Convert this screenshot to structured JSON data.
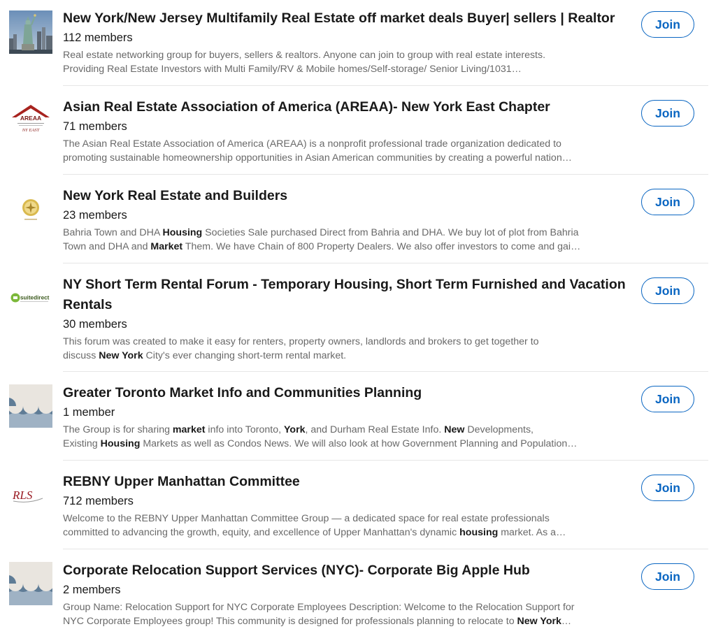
{
  "colors": {
    "accent": "#0a66c2",
    "title": "#000000e6",
    "secondary": "#00000099"
  },
  "groups": [
    {
      "title": "New York/New Jersey Multifamily Real Estate off market deals Buyer| sellers | Realtor",
      "members": "112 members",
      "logo_icon": "statue-of-liberty-photo",
      "join_label": "Join",
      "desc_lines": [
        [
          {
            "t": "Real estate networking group for buyers, sellers & realtors. Anyone can join to group with real estate interests."
          }
        ],
        [
          {
            "t": "Providing Real Estate Investors with Multi Family/RV & Mobile homes/Self-storage/ Senior Living/1031…"
          }
        ]
      ]
    },
    {
      "title": "Asian Real Estate Association of America (AREAA)- New York East Chapter",
      "members": "71 members",
      "logo_icon": "areaa-logo",
      "logo_text": "AREAA",
      "logo_sub": "NY EAST",
      "join_label": "Join",
      "desc_lines": [
        [
          {
            "t": "The Asian Real Estate Association of America (AREAA) is a nonprofit professional trade organization dedicated to"
          }
        ],
        [
          {
            "t": "promoting sustainable homeownership opportunities in Asian American communities by creating a powerful nation…"
          }
        ]
      ]
    },
    {
      "title": "New York Real Estate and Builders",
      "members": "23 members",
      "logo_icon": "gold-emblem-logo",
      "join_label": "Join",
      "desc_lines": [
        [
          {
            "t": "Bahria Town and DHA "
          },
          {
            "t": "Housing",
            "b": true
          },
          {
            "t": " Societies Sale purchased Direct from Bahria and DHA. We buy lot of plot from Bahria"
          }
        ],
        [
          {
            "t": "Town and DHA and "
          },
          {
            "t": "Market",
            "b": true
          },
          {
            "t": " Them. We have Chain of 800 Property Dealers. We also offer investors to come and gai…"
          }
        ]
      ]
    },
    {
      "title": "NY Short Term Rental Forum - Temporary Housing, Short Term Furnished and Vacation Rentals",
      "members": "30 members",
      "logo_icon": "suitedirect-logo",
      "logo_text": "suitedirect",
      "join_label": "Join",
      "desc_lines": [
        [
          {
            "t": "This forum was created to make it easy for renters, property owners, landlords and brokers to get together to"
          }
        ],
        [
          {
            "t": "discuss "
          },
          {
            "t": "New York",
            "b": true
          },
          {
            "t": " City's ever changing short-term rental market."
          }
        ]
      ]
    },
    {
      "title": "Greater Toronto Market Info and Communities Planning",
      "members": "1 member",
      "logo_icon": "default-group-logo",
      "join_label": "Join",
      "desc_lines": [
        [
          {
            "t": "The Group is for sharing "
          },
          {
            "t": "market",
            "b": true
          },
          {
            "t": " info into Toronto, "
          },
          {
            "t": "York",
            "b": true
          },
          {
            "t": ", and Durham Real Estate Info. "
          },
          {
            "t": "New",
            "b": true
          },
          {
            "t": " Developments,"
          }
        ],
        [
          {
            "t": "Existing "
          },
          {
            "t": "Housing",
            "b": true
          },
          {
            "t": " Markets as well as Condos News. We will also look at how Government Planning and Population…"
          }
        ]
      ]
    },
    {
      "title": "REBNY Upper Manhattan Committee",
      "members": "712 members",
      "logo_icon": "rls-logo",
      "logo_text": "RLS",
      "join_label": "Join",
      "desc_lines": [
        [
          {
            "t": "Welcome to the REBNY Upper Manhattan Committee Group — a dedicated space for real estate professionals"
          }
        ],
        [
          {
            "t": "committed to advancing the growth, equity, and excellence of Upper Manhattan's dynamic "
          },
          {
            "t": "housing",
            "b": true
          },
          {
            "t": " market. As a…"
          }
        ]
      ]
    },
    {
      "title": "Corporate Relocation Support Services (NYC)- Corporate Big Apple Hub",
      "members": "2 members",
      "logo_icon": "default-group-logo",
      "join_label": "Join",
      "desc_lines": [
        [
          {
            "t": "Group Name: Relocation Support for NYC Corporate Employees Description: Welcome to the Relocation Support for"
          }
        ],
        [
          {
            "t": "NYC Corporate Employees group! This community is designed for professionals planning to relocate to "
          },
          {
            "t": "New York",
            "b": true
          },
          {
            "t": "…"
          }
        ]
      ]
    }
  ]
}
